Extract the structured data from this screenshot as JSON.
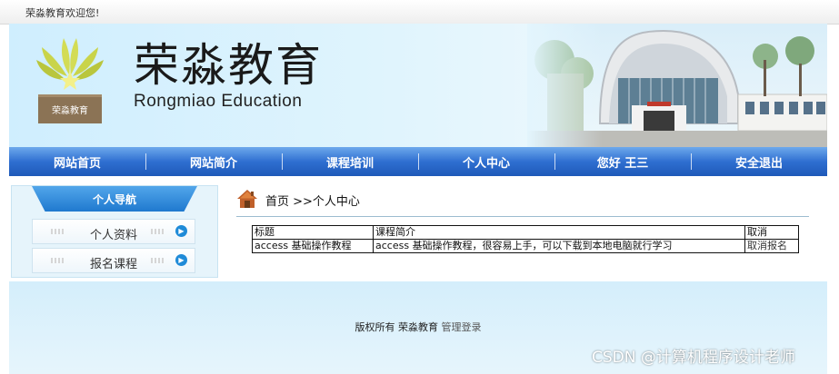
{
  "topbar": {
    "welcome": "荣淼教育欢迎您!"
  },
  "header": {
    "title": "荣淼教育",
    "subtitle": "Rongmiao Education",
    "emblem_label": "荣淼教育"
  },
  "nav": {
    "items": [
      {
        "label": "网站首页"
      },
      {
        "label": "网站简介"
      },
      {
        "label": "课程培训"
      },
      {
        "label": "个人中心"
      },
      {
        "label": "您好 王三"
      },
      {
        "label": "安全退出"
      }
    ]
  },
  "sidebar": {
    "title": "个人导航",
    "items": [
      {
        "label": "个人资料",
        "icon": "arrow-right-circle-icon"
      },
      {
        "label": "报名课程",
        "icon": "arrow-right-circle-icon"
      }
    ]
  },
  "breadcrumb": {
    "icon": "home-icon",
    "text": "首页 >>个人中心"
  },
  "courses_table": {
    "headers": [
      "标题",
      "课程简介",
      "取消"
    ],
    "rows": [
      {
        "title": "access 基础操作教程",
        "intro": "access 基础操作教程，很容易上手，可以下载到本地电脑就行学习",
        "action": "取消报名"
      }
    ]
  },
  "footer": {
    "copyright": "版权所有 荣淼教育",
    "admin_link": "管理登录"
  },
  "watermark": "CSDN @计算机程序设计老师",
  "colors": {
    "nav_blue": "#2f6fd1",
    "header_bg": "#dff4fd",
    "emblem_yellow": "#c9d44a",
    "emblem_brown": "#8b7355",
    "sidebar_head": "#1f79cf"
  }
}
